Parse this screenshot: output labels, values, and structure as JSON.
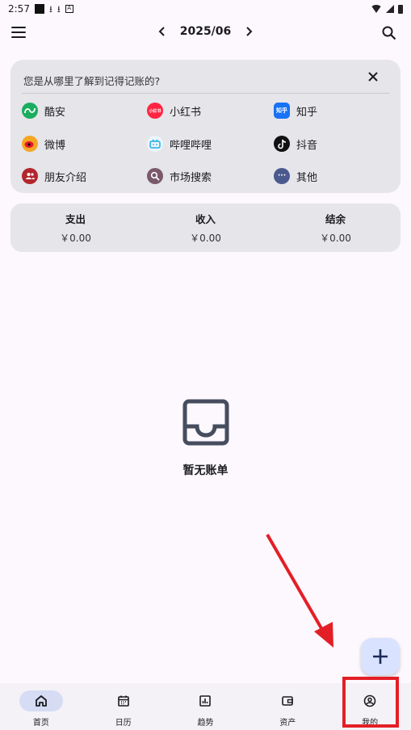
{
  "status": {
    "time": "2:57"
  },
  "header": {
    "month": "2025/06"
  },
  "survey": {
    "question": "您是从哪里了解到记得记账的?",
    "options": [
      {
        "label": "酷安",
        "icon": "coolapk-icon",
        "color": "#1aad5e",
        "glyph": ""
      },
      {
        "label": "小红书",
        "icon": "xiaohongshu-icon",
        "color": "#ff2442",
        "glyph": "小红书"
      },
      {
        "label": "知乎",
        "icon": "zhihu-icon",
        "color": "#1772f6",
        "glyph": "知乎"
      },
      {
        "label": "微博",
        "icon": "weibo-icon",
        "color": "#f5a623",
        "glyph": ""
      },
      {
        "label": "哔哩哔哩",
        "icon": "bilibili-icon",
        "color": "#e8f6fc",
        "glyph": ""
      },
      {
        "label": "抖音",
        "icon": "douyin-icon",
        "color": "#111111",
        "glyph": ""
      },
      {
        "label": "朋友介绍",
        "icon": "friends-icon",
        "color": "#b3262d",
        "glyph": ""
      },
      {
        "label": "市场搜索",
        "icon": "market-search-icon",
        "color": "#7a5a6a",
        "glyph": ""
      },
      {
        "label": "其他",
        "icon": "more-icon",
        "color": "#4a5a8f",
        "glyph": "···"
      }
    ]
  },
  "summary": {
    "expense_label": "支出",
    "expense_value": "￥0.00",
    "income_label": "收入",
    "income_value": "￥0.00",
    "balance_label": "结余",
    "balance_value": "￥0.00"
  },
  "empty_state": {
    "text": "暂无账单"
  },
  "nav": {
    "items": [
      {
        "label": "首页",
        "icon": "home-icon"
      },
      {
        "label": "日历",
        "icon": "calendar-icon"
      },
      {
        "label": "趋势",
        "icon": "chart-icon"
      },
      {
        "label": "资产",
        "icon": "wallet-icon"
      },
      {
        "label": "我的",
        "icon": "profile-icon"
      }
    ]
  },
  "colors": {
    "accent": "#d5dcf4",
    "fab": "#d9e2ff",
    "annotation": "#e41e26",
    "card": "#e6e5ea"
  }
}
